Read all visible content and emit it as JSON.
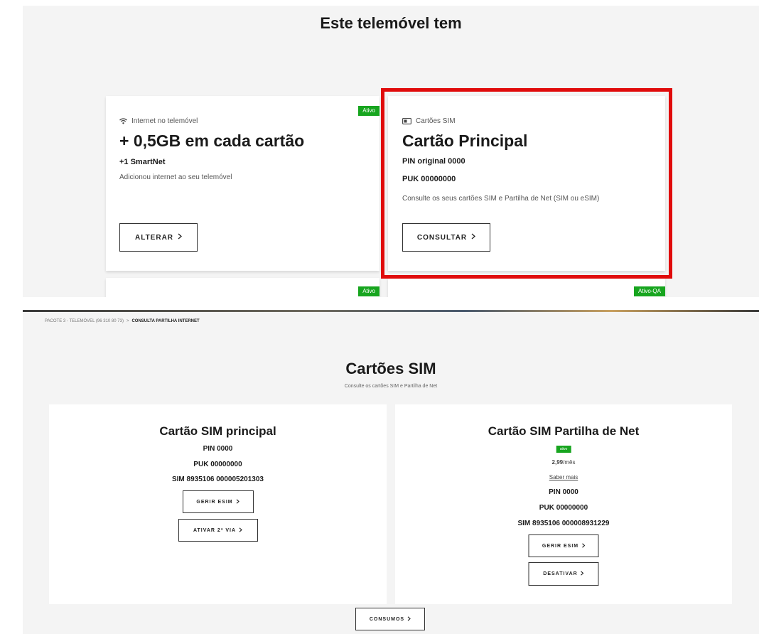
{
  "top": {
    "title": "Este telemóvel tem",
    "internet_card": {
      "badge": "Ativo",
      "kicker": "Internet no telemóvel",
      "kicker_icon": "wifi-icon",
      "headline": "+ 0,5GB em cada cartão",
      "sub": "+1 SmartNet",
      "description": "Adicionou internet ao seu telemóvel",
      "button_label": "ALTERAR",
      "button_icon": "chevron-right-icon"
    },
    "sim_card": {
      "kicker": "Cartões SIM",
      "kicker_icon": "sim-card-icon",
      "headline": "Cartão Principal",
      "pin": "PIN original 0000",
      "puk": "PUK 00000000",
      "description": "Consulte os seus cartões SIM e Partilha de Net (SIM ou eSIM)",
      "button_label": "CONSULTAR",
      "button_icon": "chevron-right-icon",
      "highlight_color": "#e00b0b"
    },
    "bottom_left_badge": "Ativo",
    "bottom_right_badge": "Ativo-QA"
  },
  "bottom": {
    "breadcrumb": {
      "parent": "PACOTE 3 - TELEMÓVEL (96 310 80 73)",
      "separator": ">",
      "current": "CONSULTA PARTILHA INTERNET"
    },
    "title": "Cartões SIM",
    "subtitle": "Consulte os cartões SIM e Partilha de Net",
    "main_sim": {
      "title": "Cartão SIM principal",
      "pin": "PIN 0000",
      "puk": "PUK 00000000",
      "sim": "SIM 8935106 000005201303",
      "btn_manage": "GERIR ESIM",
      "btn_activate": "ATIVAR 2ª VIA"
    },
    "share_sim": {
      "title": "Cartão SIM Partilha de Net",
      "badge": "ativo",
      "price": "2,99",
      "price_unit": "/mês",
      "link": "Saber mais",
      "pin": "PIN 0000",
      "puk": "PUK 00000000",
      "sim": "SIM 8935106 000008931229",
      "btn_manage": "GERIR ESIM",
      "btn_deactivate": "DESATIVAR"
    },
    "consumos_label": "CONSUMOS",
    "accent_green": "#17a51f"
  }
}
